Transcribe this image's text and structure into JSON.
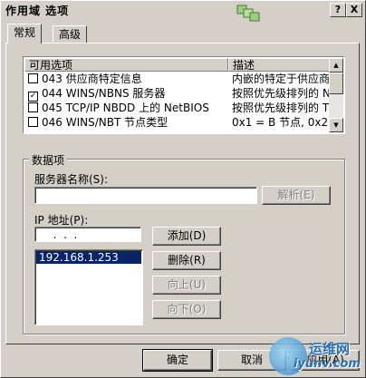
{
  "window": {
    "title": "作用域 选项",
    "help_label": "?",
    "close_label": "X"
  },
  "tabs": [
    {
      "label": "常规",
      "active": true
    },
    {
      "label": "高级",
      "active": false
    }
  ],
  "options_list": {
    "columns": [
      "可用选项",
      "描述"
    ],
    "rows": [
      {
        "checked": false,
        "option": "043 供应商特定信息",
        "description": "内嵌的特定于供应商"
      },
      {
        "checked": true,
        "option": "044 WINS/NBNS 服务器",
        "description": "按照优先级排列的 N"
      },
      {
        "checked": false,
        "option": "045 TCP/IP NBDD 上的 NetBIOS",
        "description": "按照优先级排列的 T"
      },
      {
        "checked": false,
        "option": "046 WINS/NBT 节点类型",
        "description": "0x1 = B 节点, 0x2"
      }
    ]
  },
  "data_group": {
    "title": "数据项",
    "server_name_label": "服务器名称(S):",
    "server_name_value": "",
    "resolve_button": "解析(E)",
    "ip_label": "IP 地址(P):",
    "ip_input_value": "  .  .  .",
    "add_button": "添加(D)",
    "remove_button": "删除(R)",
    "up_button": "向上(U)",
    "down_button": "向下(O)",
    "ip_list": [
      "192.168.1.253"
    ]
  },
  "footer": {
    "ok_button": "确定",
    "cancel_button": "取消",
    "apply_button": "应用(A)"
  },
  "watermark": {
    "line1": "运维网",
    "line2": "iyunv.com"
  },
  "colors": {
    "face": "#d4d0c8",
    "selection": "#0a246a"
  }
}
